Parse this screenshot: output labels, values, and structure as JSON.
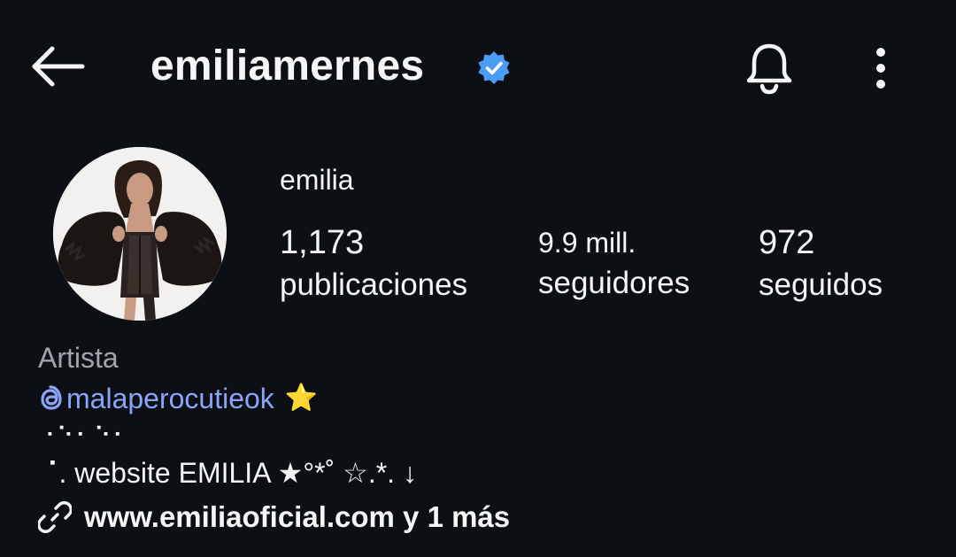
{
  "header": {
    "username": "emiliamernes",
    "verified": true,
    "accent_color": "#4b9cf5"
  },
  "icons": {
    "back": "back-arrow-icon",
    "verified": "verified-badge-icon",
    "notifications": "bell-icon",
    "more": "more-vertical-icon",
    "threads": "threads-icon",
    "link": "link-icon"
  },
  "profile": {
    "display_name": "emilia",
    "stats": {
      "posts_count": "1,173",
      "posts_label": "publicaciones",
      "followers_count": "9.9 mill.",
      "followers_label": "seguidores",
      "following_count": "972",
      "following_label": "seguidos"
    }
  },
  "bio": {
    "category": "Artista",
    "threads_handle": "malaperocutieok",
    "threads_emoji": "⭐",
    "line1": "⠐⠑⠂⠑⠂",
    "line2": "⠈. website EMILIA ★°*˚ ☆.*. ↓",
    "website": "www.emiliaoficial.com y 1 más"
  },
  "colors": {
    "background": "#0c1015",
    "text": "#f5f5f5",
    "muted": "#a0a5ad",
    "link": "#8aa4f7",
    "star": "#ffcc2f"
  }
}
